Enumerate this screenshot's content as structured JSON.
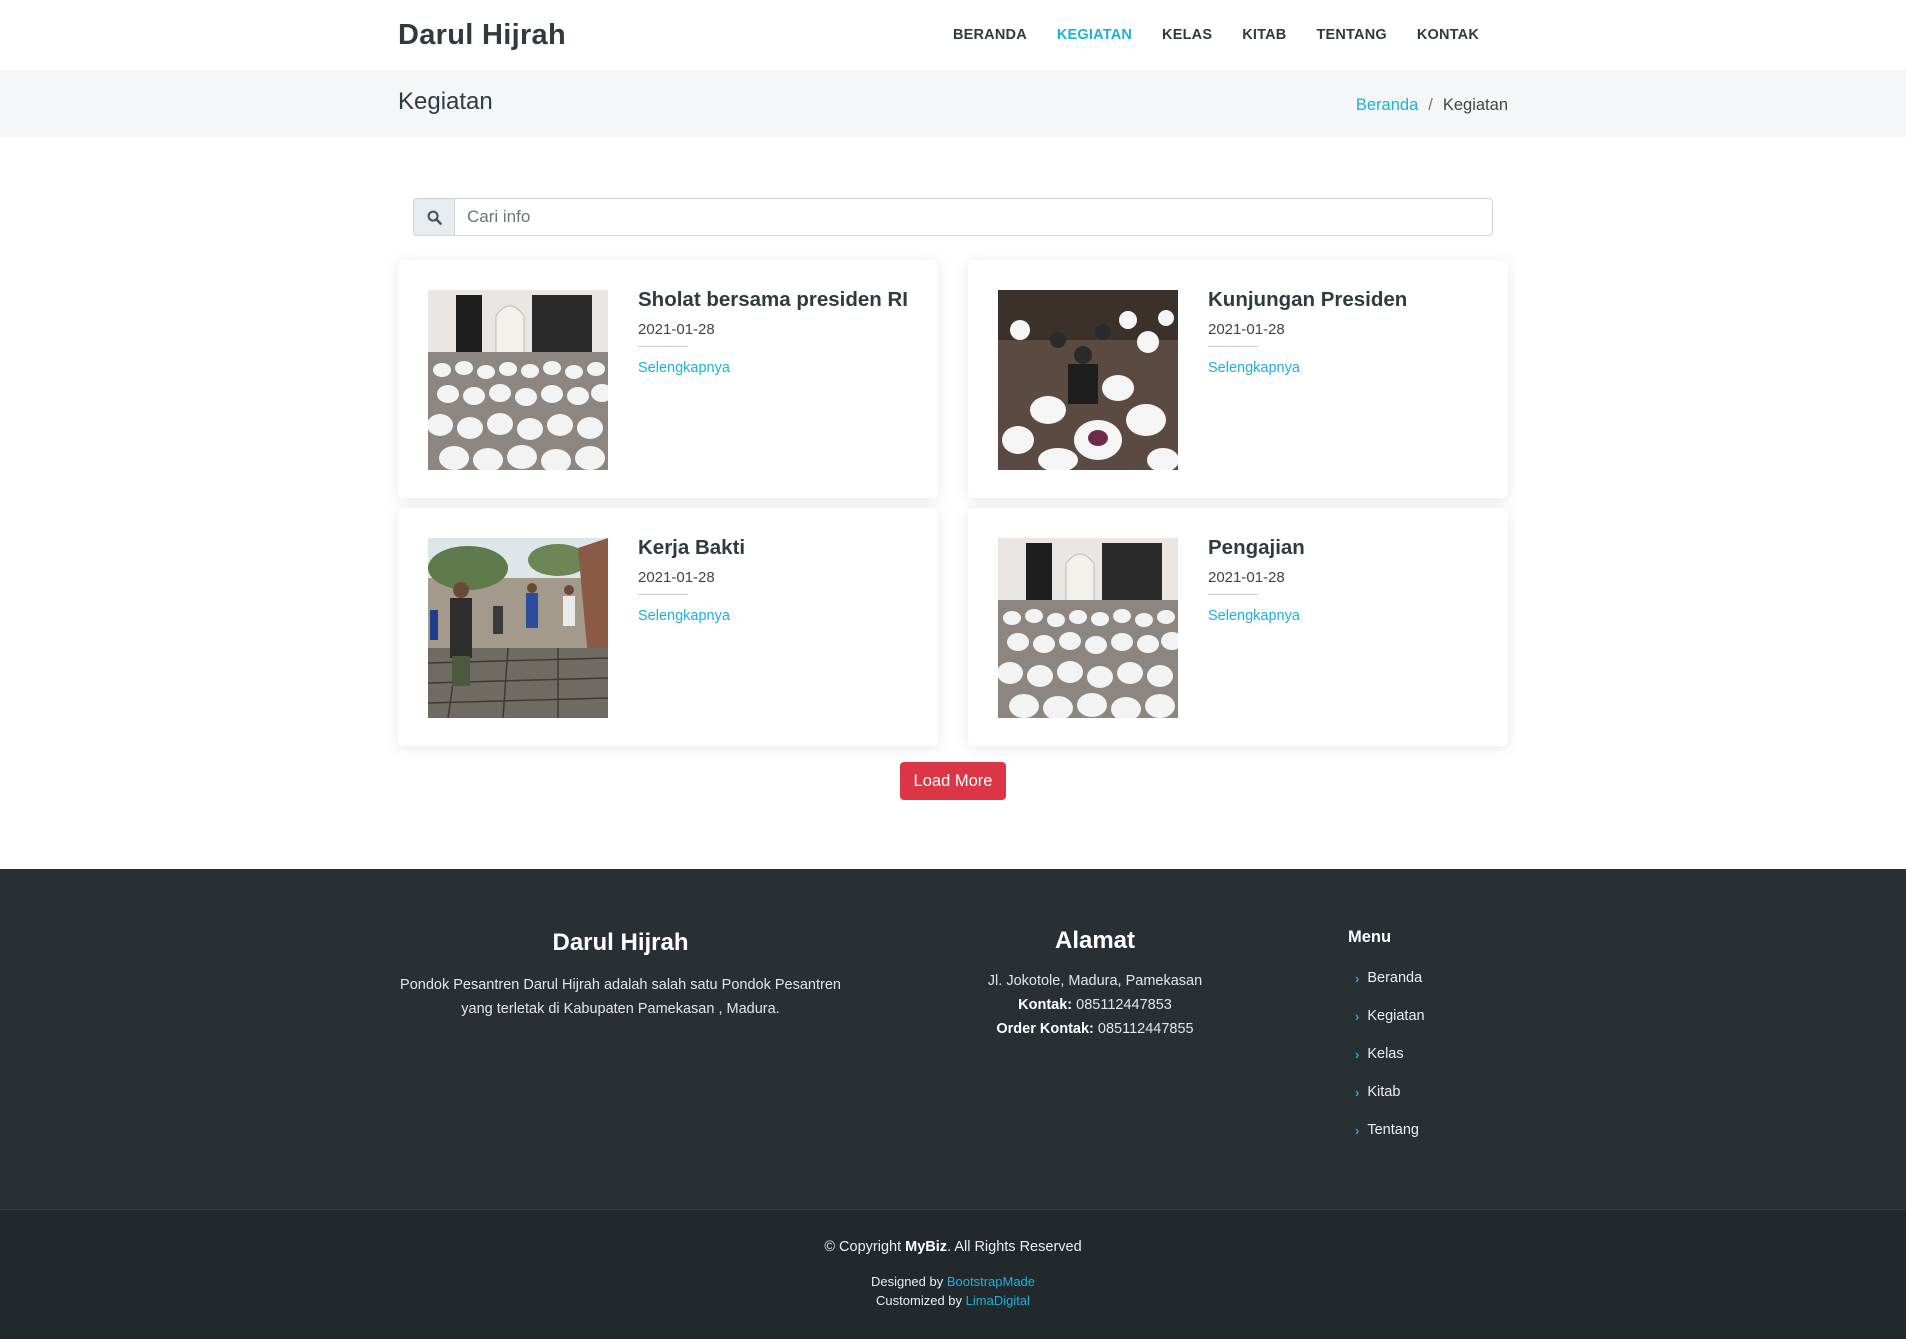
{
  "header": {
    "logo": "Darul Hijrah",
    "nav": [
      "BERANDA",
      "KEGIATAN",
      "KELAS",
      "KITAB",
      "TENTANG",
      "KONTAK"
    ],
    "active_nav": "KEGIATAN"
  },
  "page": {
    "title": "Kegiatan",
    "breadcrumb_home": "Beranda",
    "breadcrumb_sep": "/",
    "breadcrumb_current": "Kegiatan"
  },
  "search": {
    "placeholder": "Cari info",
    "value": ""
  },
  "cards": [
    {
      "title": "Sholat bersama presiden RI",
      "date": "2021-01-28",
      "more": "Selengkapnya",
      "image": "prayer-hall-crowd"
    },
    {
      "title": "Kunjungan Presiden",
      "date": "2021-01-28",
      "more": "Selengkapnya",
      "image": "president-visit-crowd"
    },
    {
      "title": "Kerja Bakti",
      "date": "2021-01-28",
      "more": "Selengkapnya",
      "image": "roof-work"
    },
    {
      "title": "Pengajian",
      "date": "2021-01-28",
      "more": "Selengkapnya",
      "image": "prayer-hall-crowd"
    }
  ],
  "load_more_label": "Load More",
  "footer": {
    "about_title": "Darul Hijrah",
    "about_text_1": "Pondok Pesantren Darul Hijrah adalah salah satu Pondok Pesantren",
    "about_text_2": "yang terletak di Kabupaten Pamekasan , Madura.",
    "address_title": "Alamat",
    "address": "Jl. Jokotole, Madura, Pamekasan",
    "contact_label": "Kontak:",
    "contact_value": "085112447853",
    "order_label": "Order Kontak:",
    "order_value": "085112447855",
    "menu_title": "Menu",
    "menu_items": [
      "Beranda",
      "Kegiatan",
      "Kelas",
      "Kitab",
      "Tentang"
    ],
    "copyright_prefix": "© Copyright",
    "copyright_brand": "MyBiz",
    "copyright_suffix": ". All Rights Reserved",
    "designed_by_label": "Designed by",
    "designed_by_link": "BootstrapMade",
    "customized_by_label": "Customized by",
    "customized_by_link": "LimaDigital"
  },
  "colors": {
    "accent": "#1bb1dc",
    "danger": "#dc3545",
    "footer_bg": "#283034",
    "footer_bottom_bg": "#22292c",
    "crumb_bg": "#f5f6f7"
  }
}
